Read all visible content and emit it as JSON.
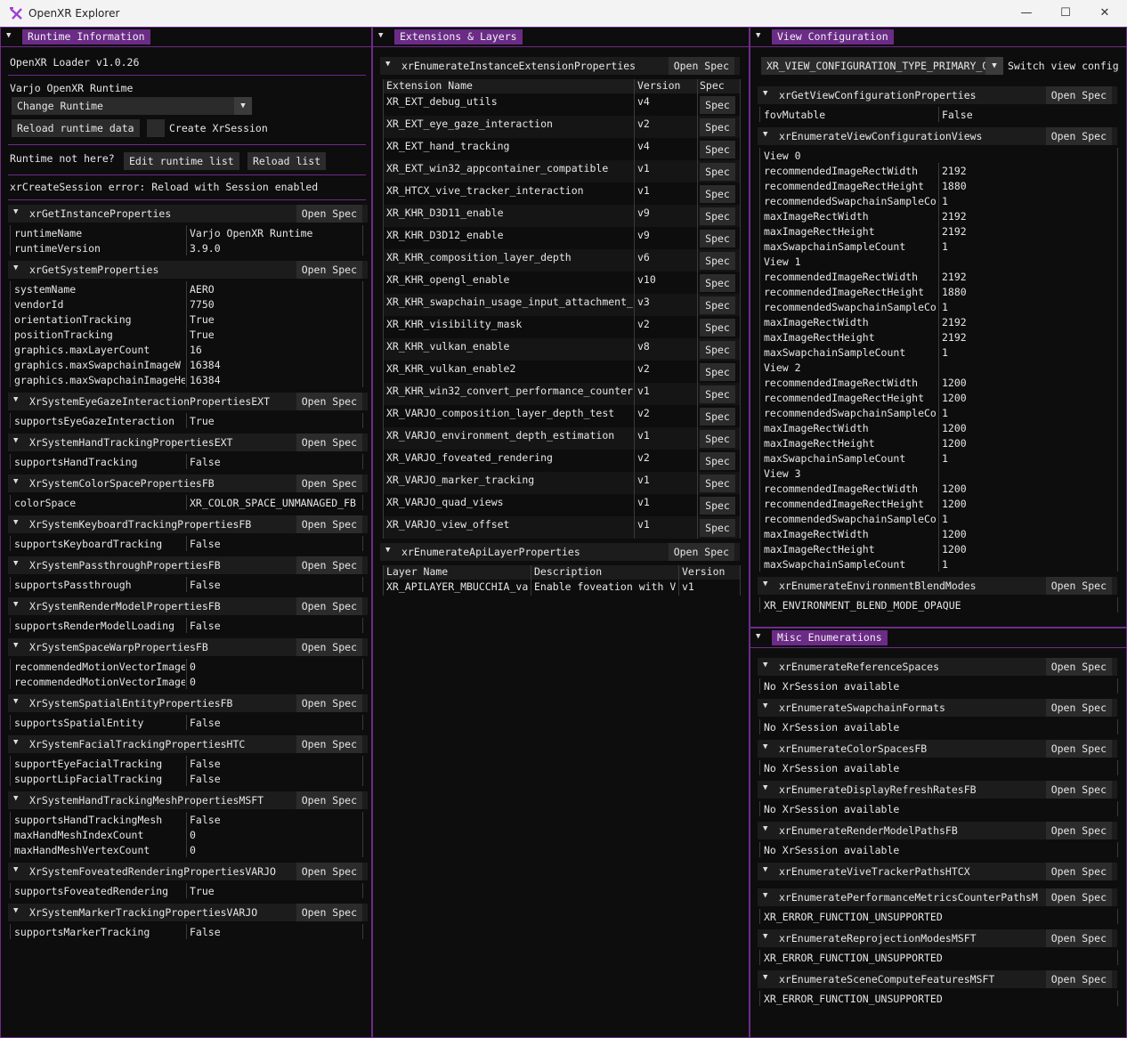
{
  "window": {
    "title": "OpenXR Explorer",
    "minimize": "—",
    "maximize": "☐",
    "close": "✕"
  },
  "runtime_panel": {
    "title": "Runtime Information",
    "loader": "OpenXR Loader v1.0.26",
    "runtime_name": "Varjo OpenXR Runtime",
    "change_runtime": "Change Runtime",
    "reload_runtime": "Reload runtime data",
    "create_session": "Create XrSession",
    "not_here": "Runtime not here?",
    "edit_list": "Edit runtime list",
    "reload_list": "Reload list",
    "session_error": "xrCreateSession error: Reload with Session enabled",
    "open_spec": "Open Spec",
    "sections": [
      {
        "name": "xrGetInstanceProperties",
        "rows": [
          [
            "runtimeName",
            "Varjo OpenXR Runtime"
          ],
          [
            "runtimeVersion",
            "3.9.0"
          ]
        ]
      },
      {
        "name": "xrGetSystemProperties",
        "rows": [
          [
            "systemName",
            "AERO"
          ],
          [
            "vendorId",
            "7750"
          ],
          [
            "orientationTracking",
            "True"
          ],
          [
            "positionTracking",
            "True"
          ],
          [
            "graphics.maxLayerCount",
            "16"
          ],
          [
            "graphics.maxSwapchainImageW",
            "16384"
          ],
          [
            "graphics.maxSwapchainImageHe",
            "16384"
          ]
        ]
      },
      {
        "name": "XrSystemEyeGazeInteractionPropertiesEXT",
        "rows": [
          [
            "supportsEyeGazeInteraction",
            "True"
          ]
        ]
      },
      {
        "name": "XrSystemHandTrackingPropertiesEXT",
        "rows": [
          [
            "supportsHandTracking",
            "False"
          ]
        ]
      },
      {
        "name": "XrSystemColorSpacePropertiesFB",
        "rows": [
          [
            "colorSpace",
            "XR_COLOR_SPACE_UNMANAGED_FB"
          ]
        ]
      },
      {
        "name": "XrSystemKeyboardTrackingPropertiesFB",
        "rows": [
          [
            "supportsKeyboardTracking",
            "False"
          ]
        ]
      },
      {
        "name": "XrSystemPassthroughPropertiesFB",
        "rows": [
          [
            "supportsPassthrough",
            "False"
          ]
        ]
      },
      {
        "name": "XrSystemRenderModelPropertiesFB",
        "rows": [
          [
            "supportsRenderModelLoading",
            "False"
          ]
        ]
      },
      {
        "name": "XrSystemSpaceWarpPropertiesFB",
        "rows": [
          [
            "recommendedMotionVectorImage",
            "0"
          ],
          [
            "recommendedMotionVectorImage",
            "0"
          ]
        ]
      },
      {
        "name": "XrSystemSpatialEntityPropertiesFB",
        "rows": [
          [
            "supportsSpatialEntity",
            "False"
          ]
        ]
      },
      {
        "name": "XrSystemFacialTrackingPropertiesHTC",
        "rows": [
          [
            "supportEyeFacialTracking",
            "False"
          ],
          [
            "supportLipFacialTracking",
            "False"
          ]
        ]
      },
      {
        "name": "XrSystemHandTrackingMeshPropertiesMSFT",
        "rows": [
          [
            "supportsHandTrackingMesh",
            "False"
          ],
          [
            "maxHandMeshIndexCount",
            "0"
          ],
          [
            "maxHandMeshVertexCount",
            "0"
          ]
        ]
      },
      {
        "name": "XrSystemFoveatedRenderingPropertiesVARJO",
        "rows": [
          [
            "supportsFoveatedRendering",
            "True"
          ]
        ]
      },
      {
        "name": "XrSystemMarkerTrackingPropertiesVARJO",
        "rows": [
          [
            "supportsMarkerTracking",
            "False"
          ]
        ]
      }
    ]
  },
  "ext_panel": {
    "title": "Extensions & Layers",
    "ext_section": "xrEnumerateInstanceExtensionProperties",
    "col_name": "Extension Name",
    "col_version": "Version",
    "col_spec": "Spec",
    "spec_btn": "Spec",
    "open_spec": "Open Spec",
    "extensions": [
      [
        "XR_EXT_debug_utils",
        "v4"
      ],
      [
        "XR_EXT_eye_gaze_interaction",
        "v2"
      ],
      [
        "XR_EXT_hand_tracking",
        "v4"
      ],
      [
        "XR_EXT_win32_appcontainer_compatible",
        "v1"
      ],
      [
        "XR_HTCX_vive_tracker_interaction",
        "v1"
      ],
      [
        "XR_KHR_D3D11_enable",
        "v9"
      ],
      [
        "XR_KHR_D3D12_enable",
        "v9"
      ],
      [
        "XR_KHR_composition_layer_depth",
        "v6"
      ],
      [
        "XR_KHR_opengl_enable",
        "v10"
      ],
      [
        "XR_KHR_swapchain_usage_input_attachment_",
        "v3"
      ],
      [
        "XR_KHR_visibility_mask",
        "v2"
      ],
      [
        "XR_KHR_vulkan_enable",
        "v8"
      ],
      [
        "XR_KHR_vulkan_enable2",
        "v2"
      ],
      [
        "XR_KHR_win32_convert_performance_counter",
        "v1"
      ],
      [
        "XR_VARJO_composition_layer_depth_test",
        "v2"
      ],
      [
        "XR_VARJO_environment_depth_estimation",
        "v1"
      ],
      [
        "XR_VARJO_foveated_rendering",
        "v2"
      ],
      [
        "XR_VARJO_marker_tracking",
        "v1"
      ],
      [
        "XR_VARJO_quad_views",
        "v1"
      ],
      [
        "XR_VARJO_view_offset",
        "v1"
      ]
    ],
    "layer_section": "xrEnumerateApiLayerProperties",
    "layer_cols": [
      "Layer Name",
      "Description",
      "Version"
    ],
    "layers": [
      [
        "XR_APILAYER_MBUCCHIA_va",
        "Enable foveation with V",
        "v1"
      ]
    ]
  },
  "view_panel": {
    "title": "View Configuration",
    "combo": "XR_VIEW_CONFIGURATION_TYPE_PRIMARY_Q",
    "switch_label": "Switch view config",
    "open_spec": "Open Spec",
    "props_section": "xrGetViewConfigurationProperties",
    "props_rows": [
      [
        "fovMutable",
        "False"
      ]
    ],
    "views_section": "xrEnumerateViewConfigurationViews",
    "views": [
      {
        "label": "View 0",
        "rows": [
          [
            "recommendedImageRectWidth",
            "2192"
          ],
          [
            "recommendedImageRectHeight",
            "1880"
          ],
          [
            "recommendedSwapchainSampleCo",
            "1"
          ],
          [
            "maxImageRectWidth",
            "2192"
          ],
          [
            "maxImageRectHeight",
            "2192"
          ],
          [
            "maxSwapchainSampleCount",
            "1"
          ]
        ]
      },
      {
        "label": "View 1",
        "rows": [
          [
            "recommendedImageRectWidth",
            "2192"
          ],
          [
            "recommendedImageRectHeight",
            "1880"
          ],
          [
            "recommendedSwapchainSampleCo",
            "1"
          ],
          [
            "maxImageRectWidth",
            "2192"
          ],
          [
            "maxImageRectHeight",
            "2192"
          ],
          [
            "maxSwapchainSampleCount",
            "1"
          ]
        ]
      },
      {
        "label": "View 2",
        "rows": [
          [
            "recommendedImageRectWidth",
            "1200"
          ],
          [
            "recommendedImageRectHeight",
            "1200"
          ],
          [
            "recommendedSwapchainSampleCo",
            "1"
          ],
          [
            "maxImageRectWidth",
            "1200"
          ],
          [
            "maxImageRectHeight",
            "1200"
          ],
          [
            "maxSwapchainSampleCount",
            "1"
          ]
        ]
      },
      {
        "label": "View 3",
        "rows": [
          [
            "recommendedImageRectWidth",
            "1200"
          ],
          [
            "recommendedImageRectHeight",
            "1200"
          ],
          [
            "recommendedSwapchainSampleCo",
            "1"
          ],
          [
            "maxImageRectWidth",
            "1200"
          ],
          [
            "maxImageRectHeight",
            "1200"
          ],
          [
            "maxSwapchainSampleCount",
            "1"
          ]
        ]
      }
    ],
    "blend_section": "xrEnumerateEnvironmentBlendModes",
    "blend_value": "XR_ENVIRONMENT_BLEND_MODE_OPAQUE"
  },
  "misc_panel": {
    "title": "Misc Enumerations",
    "open_spec": "Open Spec",
    "sections": [
      {
        "name": "xrEnumerateReferenceSpaces",
        "value": "No XrSession available"
      },
      {
        "name": "xrEnumerateSwapchainFormats",
        "value": "No XrSession available"
      },
      {
        "name": "xrEnumerateColorSpacesFB",
        "value": "No XrSession available"
      },
      {
        "name": "xrEnumerateDisplayRefreshRatesFB",
        "value": "No XrSession available"
      },
      {
        "name": "xrEnumerateRenderModelPathsFB",
        "value": "No XrSession available"
      },
      {
        "name": "xrEnumerateViveTrackerPathsHTCX",
        "value": ""
      },
      {
        "name": "xrEnumeratePerformanceMetricsCounterPathsM",
        "value": "XR_ERROR_FUNCTION_UNSUPPORTED"
      },
      {
        "name": "xrEnumerateReprojectionModesMSFT",
        "value": "XR_ERROR_FUNCTION_UNSUPPORTED"
      },
      {
        "name": "xrEnumerateSceneComputeFeaturesMSFT",
        "value": "XR_ERROR_FUNCTION_UNSUPPORTED"
      }
    ]
  }
}
